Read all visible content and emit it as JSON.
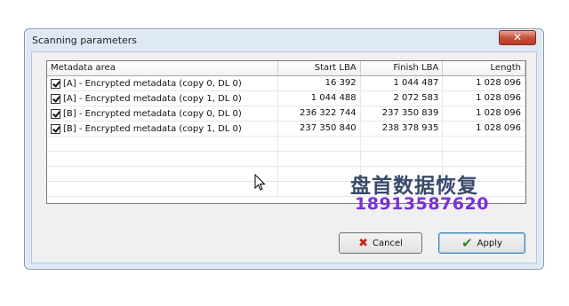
{
  "window": {
    "title": "Scanning parameters",
    "close_glyph": "✕"
  },
  "table": {
    "columns": [
      "Metadata area",
      "Start LBA",
      "Finish LBA",
      "Length"
    ],
    "rows": [
      {
        "checked": true,
        "area": "[A] - Encrypted metadata (copy 0, DL 0)",
        "start": "16 392",
        "finish": "1 044 487",
        "length": "1 028 096"
      },
      {
        "checked": true,
        "area": "[A] - Encrypted metadata (copy 1, DL 0)",
        "start": "1 044 488",
        "finish": "2 072 583",
        "length": "1 028 096"
      },
      {
        "checked": true,
        "area": "[B] - Encrypted metadata (copy 0, DL 0)",
        "start": "236 322 744",
        "finish": "237 350 839",
        "length": "1 028 096"
      },
      {
        "checked": true,
        "area": "[B] - Encrypted metadata (copy 1, DL 0)",
        "start": "237 350 840",
        "finish": "238 378 935",
        "length": "1 028 096"
      }
    ]
  },
  "buttons": {
    "cancel": "Cancel",
    "apply": "Apply"
  },
  "watermark": {
    "line1": "盘首数据恢复",
    "line2": "18913587620"
  }
}
